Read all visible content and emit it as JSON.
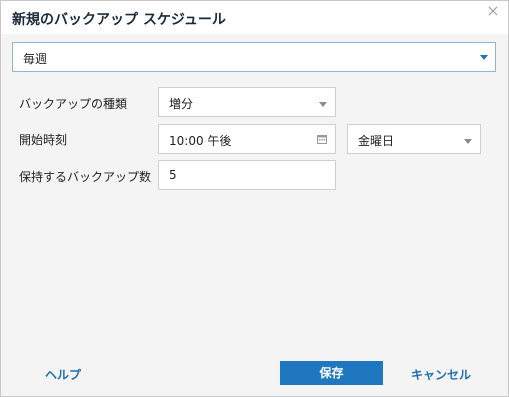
{
  "dialog": {
    "title": "新規のバックアップ スケジュール"
  },
  "frequency": {
    "value": "毎週"
  },
  "form": {
    "backup_type_label": "バックアップの種類",
    "backup_type_value": "増分",
    "start_time_label": "開始時刻",
    "start_time_value": "10:00 午後",
    "day_value": "金曜日",
    "retain_label": "保持するバックアップ数",
    "retain_value": "5"
  },
  "footer": {
    "help": "ヘルプ",
    "save": "保存",
    "cancel": "キャンセル"
  },
  "colors": {
    "accent": "#1f77bf",
    "link": "#1f6fb2",
    "border_focus": "#8fb4d8"
  }
}
